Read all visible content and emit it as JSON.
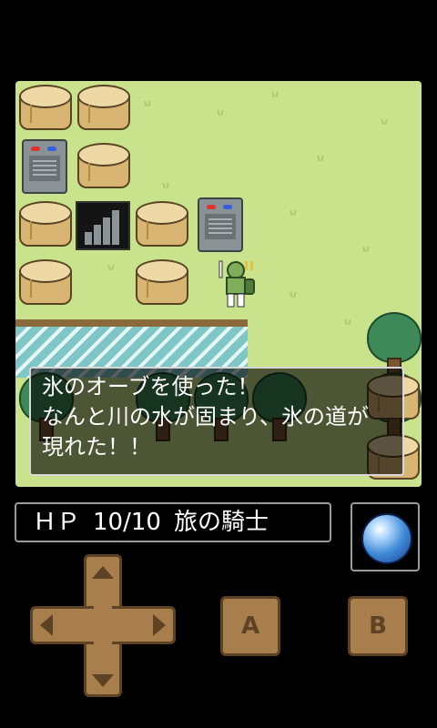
{
  "dialog": {
    "line1": "氷のオーブを使った！",
    "line2": "なんと川の水が固まり、氷の道が",
    "line3": "現れた！！"
  },
  "status": {
    "hp_label": "ＨＰ",
    "hp_value": "10/10",
    "character_title": "旅の騎士"
  },
  "item_slot": {
    "item_icon": "ice-orb-icon"
  },
  "controls": {
    "a_label": "A",
    "b_label": "B",
    "dpad_icons": [
      "arrow-up-icon",
      "arrow-down-icon",
      "arrow-left-icon",
      "arrow-right-icon"
    ]
  },
  "colors": {
    "grass": "#c9e28c",
    "river": "#7fc7c7",
    "button": "#a87e4c",
    "dialog_border": "#d8d8d8"
  }
}
